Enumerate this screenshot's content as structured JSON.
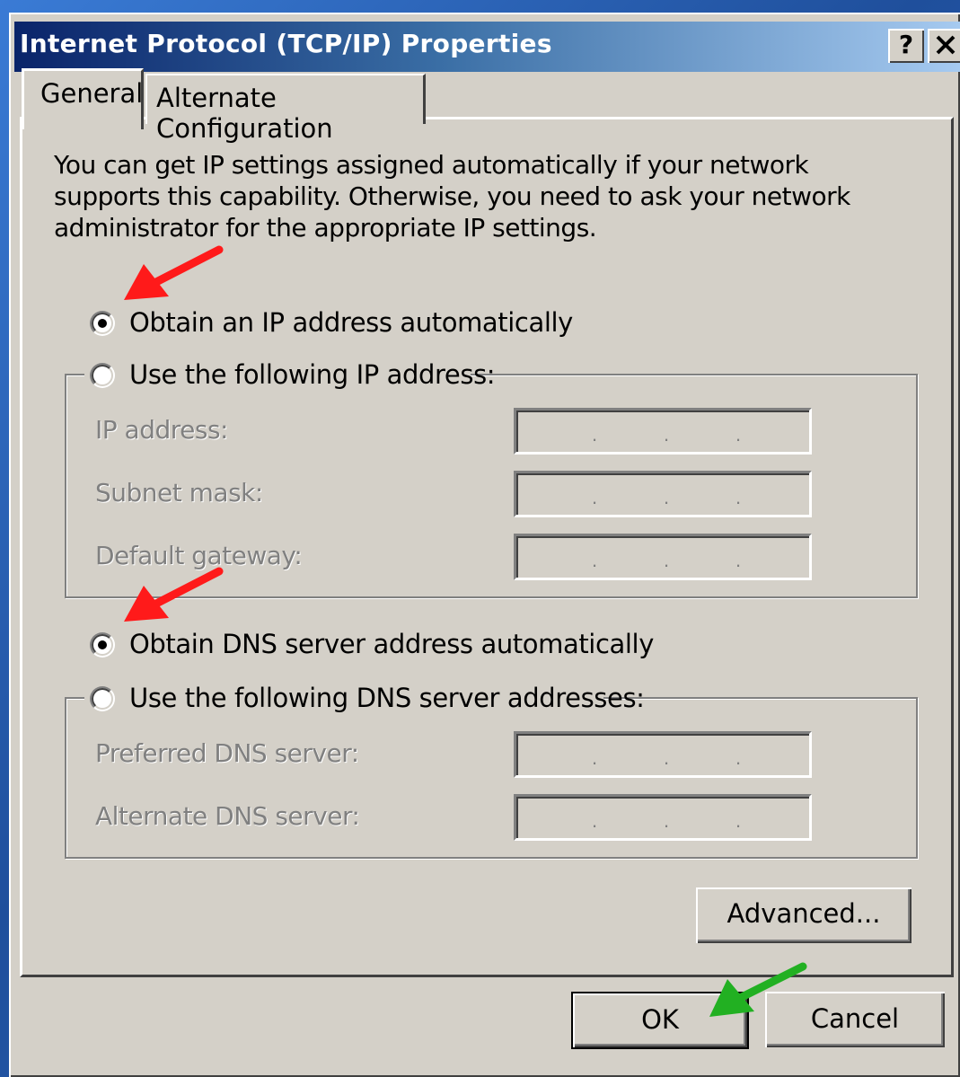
{
  "window": {
    "title": "Internet Protocol (TCP/IP) Properties",
    "help_button": "?",
    "close_button": "✕"
  },
  "tabs": [
    {
      "label": "General",
      "active": true
    },
    {
      "label": "Alternate Configuration",
      "active": false
    }
  ],
  "intro_text": "You can get IP settings assigned automatically if your network supports this capability. Otherwise, you need to ask your network administrator for the appropriate IP settings.",
  "ip_section": {
    "auto_option": {
      "label": "Obtain an IP address automatically",
      "checked": true
    },
    "manual_option": {
      "label": "Use the following IP address:",
      "checked": false
    },
    "fields": [
      {
        "label": "IP address:",
        "value": ". . ."
      },
      {
        "label": "Subnet mask:",
        "value": ". . ."
      },
      {
        "label": "Default gateway:",
        "value": ". . ."
      }
    ]
  },
  "dns_section": {
    "auto_option": {
      "label": "Obtain DNS server address automatically",
      "checked": true
    },
    "manual_option": {
      "label": "Use the following DNS server addresses:",
      "checked": false
    },
    "fields": [
      {
        "label": "Preferred DNS server:",
        "value": ". . ."
      },
      {
        "label": "Alternate DNS server:",
        "value": ". . ."
      }
    ]
  },
  "buttons": {
    "advanced": "Advanced...",
    "ok": "OK",
    "cancel": "Cancel"
  },
  "annotations": {
    "arrow_colors": {
      "red": "#ff1a1a",
      "green": "#22b022"
    }
  },
  "colors": {
    "dialog_face": "#d4d0c8",
    "title_gradient_start": "#0a246a",
    "title_gradient_end": "#a6caf0",
    "disabled_text": "#808080"
  }
}
